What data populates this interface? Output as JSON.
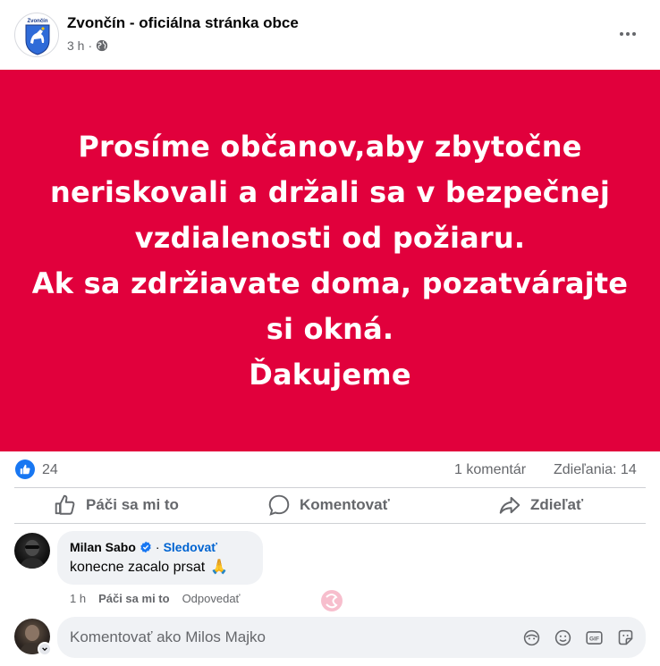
{
  "post": {
    "page_name": "Zvončín - oficiálna stránka obce",
    "avatar_caption": "Zvončín",
    "time": "3 h",
    "time_separator": "·",
    "audience_icon": "globe-icon",
    "more_icon": "more-options-icon"
  },
  "card": {
    "background": "#e1003c",
    "lines": [
      "Prosíme občanov,aby zbytočne",
      "neriskovali a držali sa v bezpečnej",
      "vzdialenosti od požiaru.",
      "Ak sa zdržiavate doma, pozatvárajte",
      "si okná.",
      "Ďakujeme"
    ]
  },
  "stats": {
    "likes": "24",
    "comments": "1 komentár",
    "shares": "Zdieľania: 14"
  },
  "actions": {
    "like": "Páči sa mi to",
    "comment": "Komentovať",
    "share": "Zdieľať"
  },
  "comment": {
    "author": "Milan Sabo",
    "separator": "·",
    "follow": "Sledovať",
    "text": "konecne zacalo prsat",
    "emoji": "🙏",
    "time": "1 h",
    "like": "Páči sa mi to",
    "reply": "Odpovedať"
  },
  "composer": {
    "placeholder": "Komentovať ako Milos Majko",
    "tools": [
      "avatar-sticker-icon",
      "emoji-icon",
      "gif-icon",
      "sticker-icon"
    ]
  },
  "colors": {
    "accent": "#1877f2",
    "link": "#0064d1",
    "muted": "#65676b"
  }
}
